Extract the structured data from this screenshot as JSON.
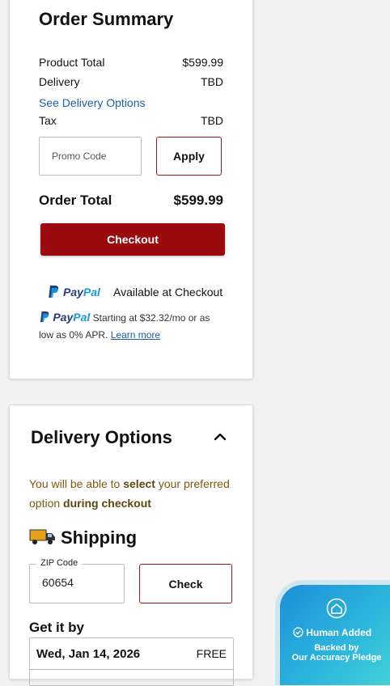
{
  "order_summary": {
    "title": "Order Summary",
    "product_total_label": "Product Total",
    "product_total_value": "$599.99",
    "delivery_label": "Delivery",
    "delivery_value": "TBD",
    "see_delivery_options": "See Delivery Options",
    "tax_label": "Tax",
    "tax_value": "TBD",
    "promo_placeholder": "Promo Code",
    "apply_label": "Apply",
    "order_total_label": "Order Total",
    "order_total_value": "$599.99",
    "checkout_label": "Checkout",
    "paypal_logo_a": "Pay",
    "paypal_logo_b": "Pal",
    "paypal_available": "Available at Checkout",
    "paypal_credit_text": "Starting at $32.32/mo or as low as 0% APR.",
    "learn_more": "Learn more"
  },
  "delivery_options": {
    "title": "Delivery Options",
    "message_part1": "You will be able to ",
    "message_bold1": "select",
    "message_part2": " your preferred option ",
    "message_bold2": "during checkout",
    "shipping_label": "Shipping",
    "zip_label": "ZIP Code",
    "zip_value": "60654",
    "check_label": "Check",
    "get_it_by_label": "Get it by",
    "date": "Wed, Jan 14, 2026",
    "date_price": "FREE"
  },
  "accuracy_badge": {
    "line1": "Human Added",
    "line2": "Backed by",
    "line3": "Our Accuracy Pledge"
  },
  "colors": {
    "accent_red": "#9b0a0f",
    "link_blue": "#1d5fa8",
    "message_brown": "#7a5a12",
    "paypal_dark": "#253b80",
    "paypal_light": "#179bd7"
  },
  "icons": [
    "paypal-logo-icon",
    "chevron-up-icon",
    "truck-icon",
    "home-icon",
    "check-circle-icon"
  ]
}
